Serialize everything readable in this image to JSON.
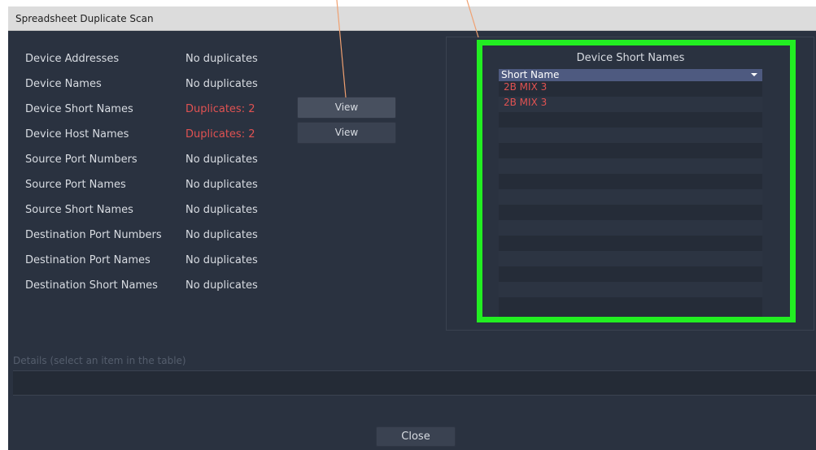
{
  "window": {
    "title": "Spreadsheet Duplicate Scan"
  },
  "scan": {
    "rows": [
      {
        "label": "Device Addresses",
        "status": "No duplicates",
        "duplicate": false
      },
      {
        "label": "Device Names",
        "status": "No duplicates",
        "duplicate": false
      },
      {
        "label": "Device Short Names",
        "status": "Duplicates: 2",
        "duplicate": true,
        "view_label": "View"
      },
      {
        "label": "Device Host Names",
        "status": "Duplicates: 2",
        "duplicate": true,
        "view_label": "View"
      },
      {
        "label": "Source Port Numbers",
        "status": "No duplicates",
        "duplicate": false
      },
      {
        "label": "Source Port Names",
        "status": "No duplicates",
        "duplicate": false
      },
      {
        "label": "Source Short Names",
        "status": "No duplicates",
        "duplicate": false
      },
      {
        "label": "Destination Port Numbers",
        "status": "No duplicates",
        "duplicate": false
      },
      {
        "label": "Destination Port Names",
        "status": "No duplicates",
        "duplicate": false
      },
      {
        "label": "Destination Short Names",
        "status": "No duplicates",
        "duplicate": false
      }
    ]
  },
  "results_panel": {
    "title": "Device Short Names",
    "column_header": "Short Name",
    "rows": [
      "2B MIX 3",
      "2B MIX 3"
    ]
  },
  "details": {
    "label": "Details (select an item in the table)",
    "value": ""
  },
  "footer": {
    "close_label": "Close"
  },
  "colors": {
    "background": "#2a3240",
    "duplicate_text": "#e05252",
    "highlight_box": "#22ee22",
    "callout_line": "#f0a070",
    "header_bg": "#4e5a80"
  }
}
